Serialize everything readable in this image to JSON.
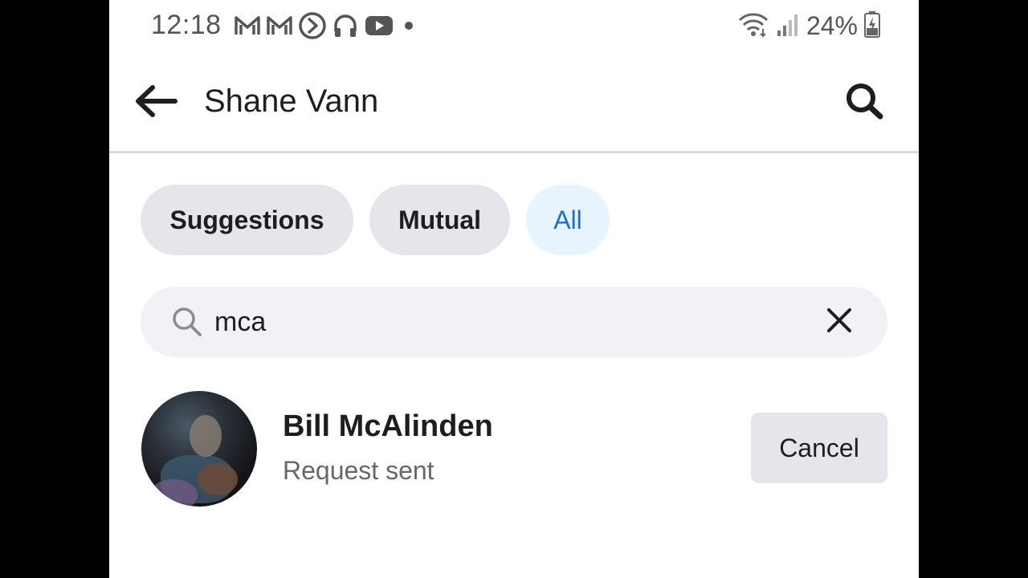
{
  "status_bar": {
    "time": "12:18",
    "notification_icons": [
      "gmail-icon",
      "gmail-icon",
      "play-circle-icon",
      "headphones-icon",
      "youtube-icon",
      "dot-icon"
    ],
    "battery_percent": "24%"
  },
  "header": {
    "title": "Shane Vann"
  },
  "tabs": [
    {
      "label": "Suggestions",
      "active": false
    },
    {
      "label": "Mutual",
      "active": false
    },
    {
      "label": "All",
      "active": true
    }
  ],
  "search": {
    "value": "mca"
  },
  "results": [
    {
      "name": "Bill McAlinden",
      "status": "Request sent",
      "action_label": "Cancel"
    }
  ],
  "colors": {
    "accent": "#1b6ed4",
    "active_tab_bg": "#e7f3ff",
    "chip_bg": "#e4e6eb",
    "text_primary": "#1c1e21",
    "text_secondary": "#65676b"
  }
}
